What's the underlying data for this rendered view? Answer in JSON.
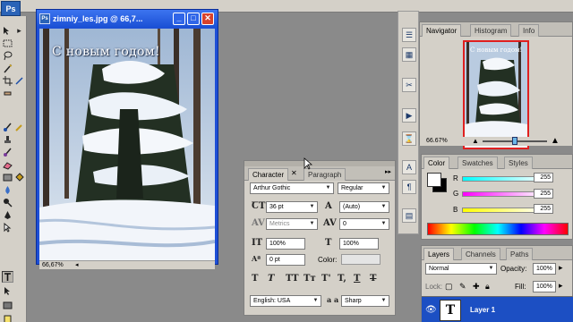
{
  "app": {
    "logo": "Ps"
  },
  "document": {
    "title": "zimniy_les.jpg @ 66,7...",
    "zoom": "66,67%",
    "canvas_text": "С новым годом!",
    "buttons": {
      "minimize": "_",
      "maximize": "□",
      "close": "✕"
    }
  },
  "navigator": {
    "tabs": [
      "Navigator",
      "Histogram",
      "Info"
    ],
    "zoom": "66.67%",
    "thumb_text": "С новым годом!",
    "zoom_level": 0.5
  },
  "color": {
    "tabs": [
      "Color",
      "Swatches",
      "Styles"
    ],
    "channels": [
      {
        "label": "R",
        "value": "255"
      },
      {
        "label": "G",
        "value": "255"
      },
      {
        "label": "B",
        "value": "255"
      }
    ],
    "foreground": "#ffffff",
    "background": "#000000"
  },
  "layers": {
    "tabs": [
      "Layers",
      "Channels",
      "Paths"
    ],
    "blend_mode": "Normal",
    "opacity_label": "Opacity:",
    "opacity": "100%",
    "lock_label": "Lock:",
    "fill_label": "Fill:",
    "fill": "100%",
    "layer_name": "Layer 1",
    "layer_thumb": "T"
  },
  "character": {
    "tabs": [
      "Character",
      "Paragraph"
    ],
    "font_family": "Arthur Gothic",
    "font_style": "Regular",
    "size": "36 pt",
    "leading": "(Auto)",
    "kerning": "Metrics",
    "tracking": "0",
    "vscale": "100%",
    "hscale": "100%",
    "baseline": "0 pt",
    "color_label": "Color:",
    "style_buttons": [
      "T",
      "T",
      "TT",
      "Tт",
      "T'",
      "T,",
      "T",
      "T"
    ],
    "language": "English: USA",
    "antialias": "Sharp",
    "antialias_label": "a a"
  }
}
